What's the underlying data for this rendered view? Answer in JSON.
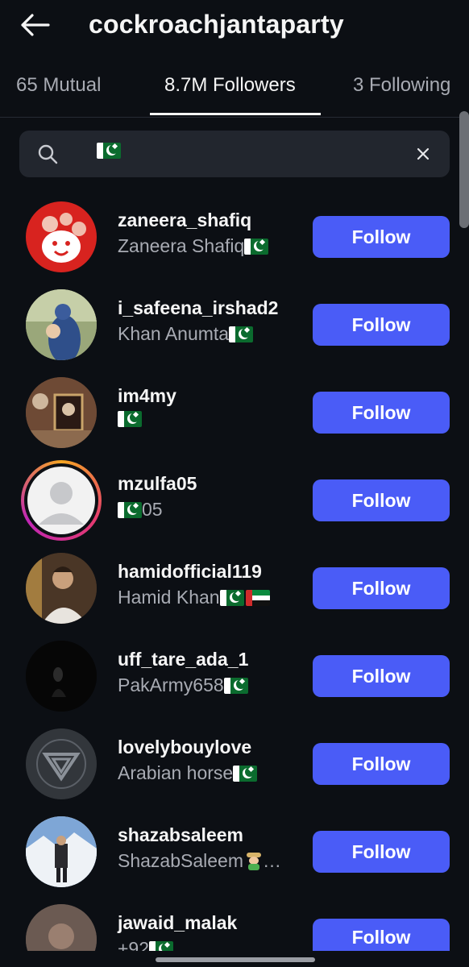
{
  "header": {
    "title": "cockroachjantaparty"
  },
  "tabs": [
    {
      "label": "65 Mutual"
    },
    {
      "label": "8.7M Followers"
    },
    {
      "label": "3 Following"
    }
  ],
  "search": {
    "value_icon": "pakistan-flag-emoji"
  },
  "followers": [
    {
      "username": "zaneera_shafiq",
      "name": "Zaneera Shafiq",
      "button": "Follow"
    },
    {
      "username": "i_safeena_irshad2",
      "name": "Khan Anumta",
      "button": "Follow"
    },
    {
      "username": "im4my",
      "name": "",
      "button": "Follow"
    },
    {
      "username": "mzulfa05",
      "name": "05",
      "button": "Follow"
    },
    {
      "username": "hamidofficial119",
      "name": "Hamid Khan ",
      "button": "Follow"
    },
    {
      "username": "uff_tare_ada_1",
      "name": "PakArmy658",
      "button": "Follow"
    },
    {
      "username": "lovelybouylove",
      "name": "Arabian horse ",
      "button": "Follow"
    },
    {
      "username": "shazabsaleem",
      "name": "ShazabSaleem",
      "name_suffix": "…",
      "button": "Follow"
    },
    {
      "username": "jawaid_malak",
      "name": "+92",
      "button": "Follow"
    }
  ],
  "colors": {
    "background": "#0c0f14",
    "accent": "#4a5cf7",
    "secondary_text": "#a8abb3"
  }
}
